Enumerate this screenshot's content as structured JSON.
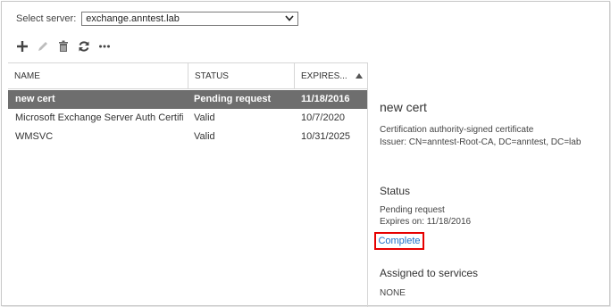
{
  "server": {
    "label": "Select server:",
    "value": "exchange.anntest.lab"
  },
  "toolbar": {
    "icons": [
      "add-icon",
      "edit-icon",
      "delete-icon",
      "refresh-icon",
      "more-icon"
    ]
  },
  "grid": {
    "columns": [
      "NAME",
      "STATUS",
      "EXPIRES..."
    ],
    "rows": [
      {
        "name": "new cert",
        "status": "Pending request",
        "expires": "11/18/2016"
      },
      {
        "name": "Microsoft Exchange Server Auth Certifi...",
        "status": "Valid",
        "expires": "10/7/2020"
      },
      {
        "name": "WMSVC",
        "status": "Valid",
        "expires": "10/31/2025"
      }
    ]
  },
  "details": {
    "title": "new cert",
    "type": "Certification authority-signed certificate",
    "issuer": "Issuer: CN=anntest-Root-CA, DC=anntest, DC=lab",
    "status_heading": "Status",
    "status_value": "Pending request",
    "expires_on": "Expires on: 11/18/2016",
    "complete_link": "Complete",
    "services_heading": "Assigned to services",
    "services_value": "NONE"
  },
  "colors": {
    "selected_row": "#6e6e6e",
    "link": "#1e6fc7",
    "highlight_box": "#e60000"
  }
}
